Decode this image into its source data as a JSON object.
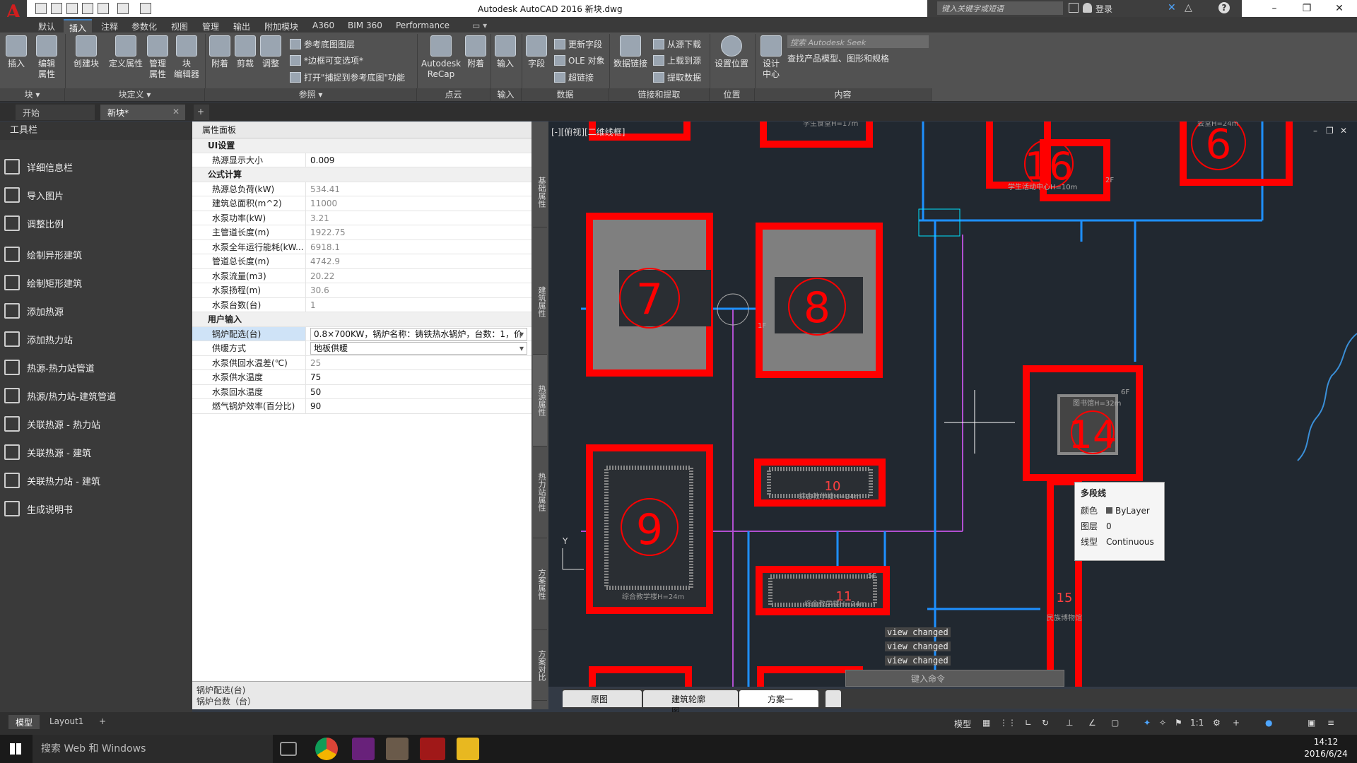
{
  "app": {
    "window_title": "Autodesk AutoCAD 2016   新块.dwg",
    "search_placeholder": "键入关键字或短语",
    "login": "登录",
    "logo_icon": "autocad-a-icon"
  },
  "ribbon_tabs": [
    "默认",
    "插入",
    "注释",
    "参数化",
    "视图",
    "管理",
    "输出",
    "附加模块",
    "A360",
    "BIM 360",
    "Performance"
  ],
  "ribbon_active_tab": "插入",
  "ribbon": {
    "insert": "插入",
    "edit_attr": "编辑\n属性",
    "create_block": "创建块",
    "define_attr": "定义属性",
    "manage_attr": "管理\n属性",
    "block_editor": "块\n编辑器",
    "attach": "附着",
    "clip": "剪裁",
    "adjust": "调整",
    "ref_underlay_layers": "参考底图图层",
    "frame_variable": "*边框可变选项*",
    "snap_underlay": "打开\"捕捉到参考底图\"功能",
    "recap": "Autodesk\nReCap",
    "attach2": "附着",
    "import": "输入",
    "field": "字段",
    "update_fields": "更新字段",
    "ole_object": "OLE 对象",
    "hyperlink": "超链接",
    "data_link": "数据链接",
    "download_source": "从源下载",
    "upload_source": "上载到源",
    "extract_data": "提取数据",
    "set_location": "设置位置",
    "design_center": "设计\n中心",
    "seek_placeholder": "搜索 Autodesk Seek",
    "seek_desc": "查找产品模型、图形和规格",
    "panel_block": "块 ▾",
    "panel_block_def": "块定义 ▾",
    "panel_reference": "参照 ▾",
    "panel_pointcloud": "点云",
    "panel_import": "输入",
    "panel_data": "数据",
    "panel_link_extract": "链接和提取",
    "panel_location": "位置",
    "panel_content": "内容"
  },
  "doc_tabs": [
    "开始",
    "新块*"
  ],
  "doc_tab_active": "新块*",
  "toolbar_palette": {
    "title": "工具栏",
    "items": [
      {
        "label": "详细信息栏",
        "icon": "pencil-icon"
      },
      {
        "label": "导入图片",
        "icon": "image-import-icon"
      },
      {
        "label": "调整比例",
        "icon": "scale-icon"
      },
      {
        "label": "绘制异形建筑",
        "icon": "polygon-draw-icon"
      },
      {
        "label": "绘制矩形建筑",
        "icon": "rectangle-draw-icon"
      },
      {
        "label": "添加热源",
        "icon": "heat-source-icon"
      },
      {
        "label": "添加热力站",
        "icon": "heat-station-icon"
      },
      {
        "label": "热源-热力站管道",
        "icon": "pipe-icon"
      },
      {
        "label": "热源/热力站-建筑管道",
        "icon": "pipe-building-icon"
      },
      {
        "label": "关联热源 - 热力站",
        "icon": "link-icon"
      },
      {
        "label": "关联热源 - 建筑",
        "icon": "link-icon"
      },
      {
        "label": "关联热力站 - 建筑",
        "icon": "link-icon"
      },
      {
        "label": "生成说明书",
        "icon": "document-icon"
      }
    ]
  },
  "property_panel": {
    "title": "属性面板",
    "rows": [
      {
        "type": "cat",
        "k": "UI设置"
      },
      {
        "type": "row",
        "k": "热源显示大小",
        "v": "0.009"
      },
      {
        "type": "cat",
        "k": "公式计算"
      },
      {
        "type": "row",
        "k": "热源总负荷(kW)",
        "v": "534.41",
        "gray": true
      },
      {
        "type": "row",
        "k": "建筑总面积(m^2)",
        "v": "11000",
        "gray": true
      },
      {
        "type": "row",
        "k": "水泵功率(kW)",
        "v": "3.21",
        "gray": true
      },
      {
        "type": "row",
        "k": "主管道长度(m)",
        "v": "1922.75",
        "gray": true
      },
      {
        "type": "row",
        "k": "水泵全年运行能耗(kW...",
        "v": "6918.1",
        "gray": true
      },
      {
        "type": "row",
        "k": "管道总长度(m)",
        "v": "4742.9",
        "gray": true
      },
      {
        "type": "row",
        "k": "水泵流量(m3)",
        "v": "20.22",
        "gray": true
      },
      {
        "type": "row",
        "k": "水泵扬程(m)",
        "v": "30.6",
        "gray": true
      },
      {
        "type": "row",
        "k": "水泵台数(台)",
        "v": "1",
        "gray": true
      },
      {
        "type": "cat",
        "k": "用户输入"
      },
      {
        "type": "dd",
        "k": "锅炉配选(台)",
        "v": "0.8×700KW，锅炉名称：铸铁热水锅炉，台数：1，价",
        "sel": true
      },
      {
        "type": "dd",
        "k": "供暖方式",
        "v": "地板供暖"
      },
      {
        "type": "row",
        "k": "水泵供回水温差(℃)",
        "v": "25",
        "gray": true
      },
      {
        "type": "row",
        "k": "水泵供水温度",
        "v": "75"
      },
      {
        "type": "row",
        "k": "水泵回水温度",
        "v": "50"
      },
      {
        "type": "row",
        "k": "燃气锅炉效率(百分比)",
        "v": "90"
      }
    ],
    "footer_title": "锅炉配选(台)",
    "footer_desc": "锅炉台数（台）"
  },
  "side_tabs": [
    "基础属性",
    "建筑属性",
    "热源属性",
    "热力站属性",
    "方案属性",
    "方案对比"
  ],
  "viewport": {
    "label": "[-][俯视][二维线框]",
    "buildings": [
      {
        "num": "7",
        "label": ""
      },
      {
        "num": "8",
        "label": ""
      },
      {
        "num": "9",
        "label": "综合教学楼H=24m"
      },
      {
        "num": "6",
        "label": "会堂H=24m"
      },
      {
        "num": "16",
        "label": "学生活动中心H=10m"
      },
      {
        "num": "14",
        "label": "图书馆H=32m"
      },
      {
        "num": "15",
        "label": "民族博物馆"
      },
      {
        "num": "10",
        "label": "综合教学楼H=24m"
      },
      {
        "num": "11",
        "label": "综合教学楼H=24m"
      }
    ],
    "floor_labels": [
      "6F",
      "2F",
      "1F",
      "5F"
    ],
    "student_canteen": "学生食堂H=17m",
    "axis_y": "Y",
    "view_changed": [
      "view changed",
      "view changed",
      "view changed"
    ],
    "command_placeholder": "键入命令",
    "colors": {
      "building": "#ff0000",
      "pipe_blue": "#1e90ff",
      "pipe_purple": "#b04fd0",
      "floor_gray": "#7f7f7f",
      "bg": "#212830"
    }
  },
  "tooltip": {
    "title": "多段线",
    "rows": [
      {
        "k": "颜色",
        "v": "ByLayer"
      },
      {
        "k": "图层",
        "v": "0"
      },
      {
        "k": "线型",
        "v": "Continuous"
      }
    ]
  },
  "layout_tabs": [
    "原图",
    "建筑轮廓图",
    "方案一"
  ],
  "model_tabs": [
    "模型",
    "Layout1"
  ],
  "status": {
    "model": "模型",
    "scale": "1:1"
  },
  "taskbar": {
    "search": "搜索 Web 和 Windows",
    "time": "14:12",
    "date": "2016/6/24"
  }
}
